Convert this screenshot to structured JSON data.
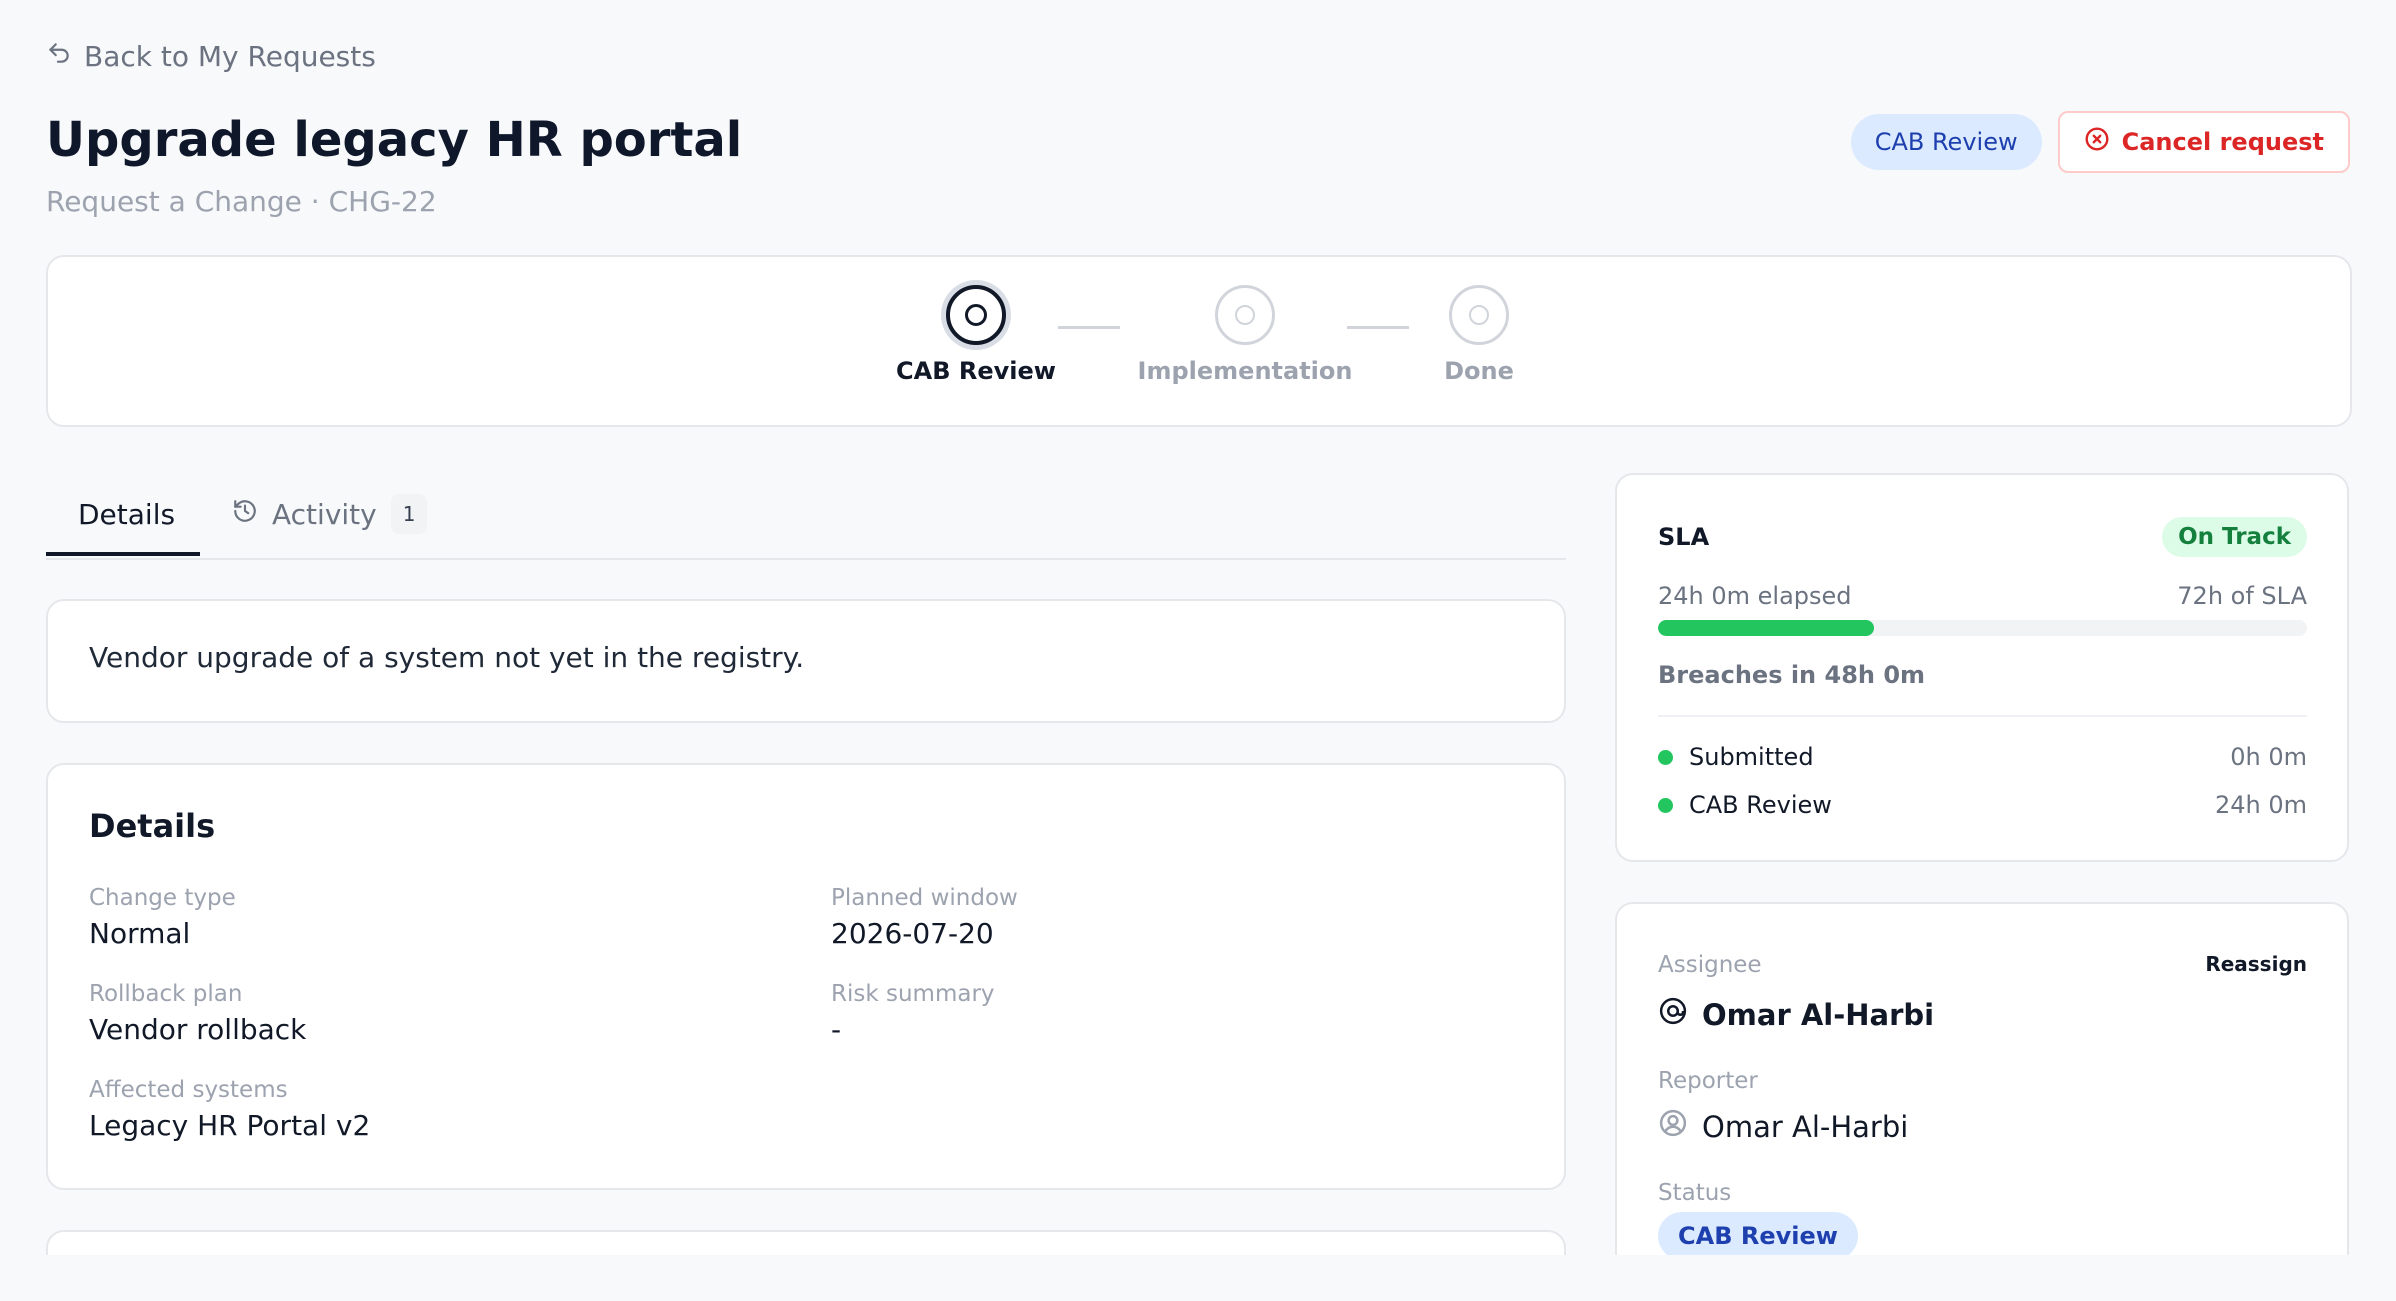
{
  "nav": {
    "back_label": "Back to My Requests"
  },
  "header": {
    "title": "Upgrade legacy HR portal",
    "subtitle": "Request a Change · CHG-22",
    "status_pill": "CAB Review",
    "cancel_label": "Cancel request"
  },
  "stepper": {
    "steps": [
      {
        "label": "CAB Review",
        "state": "current"
      },
      {
        "label": "Implementation",
        "state": "pending"
      },
      {
        "label": "Done",
        "state": "pending"
      }
    ]
  },
  "tabs": [
    {
      "label": "Details",
      "active": true
    },
    {
      "label": "Activity",
      "count": "1",
      "active": false
    }
  ],
  "description": "Vendor upgrade of a system not yet in the registry.",
  "details": {
    "heading": "Details",
    "fields": [
      {
        "label": "Change type",
        "value": "Normal"
      },
      {
        "label": "Planned window",
        "value": "2026-07-20"
      },
      {
        "label": "Rollback plan",
        "value": "Vendor rollback"
      },
      {
        "label": "Risk summary",
        "value": "-"
      },
      {
        "label": "Affected systems",
        "value": "Legacy HR Portal v2"
      }
    ]
  },
  "sla": {
    "title": "SLA",
    "status": "On Track",
    "elapsed": "24h 0m elapsed",
    "total": "72h of SLA",
    "progress_fraction": 0.333,
    "breach": "Breaches in 48h 0m",
    "timeline": [
      {
        "label": "Submitted",
        "time": "0h 0m"
      },
      {
        "label": "CAB Review",
        "time": "24h 0m"
      }
    ]
  },
  "people": {
    "assignee_label": "Assignee",
    "assignee": "Omar Al-Harbi",
    "reassign_label": "Reassign",
    "reporter_label": "Reporter",
    "reporter": "Omar Al-Harbi",
    "status_label": "Status",
    "status": "CAB Review"
  },
  "colors": {
    "accent_blue": "#1e40af",
    "pill_blue_bg": "#dbeafe",
    "success": "#22c55e",
    "danger": "#dc2626"
  }
}
